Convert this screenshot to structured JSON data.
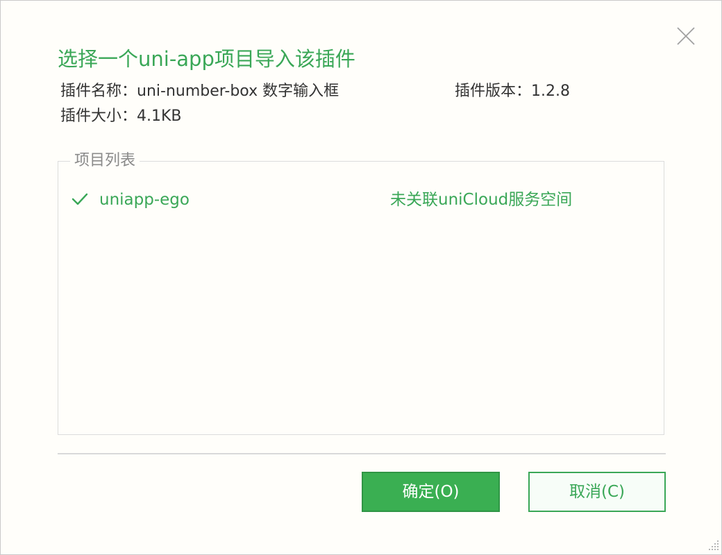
{
  "dialog": {
    "title": "选择一个uni-app项目导入该插件",
    "close_icon": "close-icon"
  },
  "plugin": {
    "name_text": "插件名称：uni-number-box 数字输入框",
    "version_text": "插件版本：1.2.8",
    "size_text": "插件大小：4.1KB"
  },
  "project_list": {
    "legend": "项目列表",
    "items": [
      {
        "name": "uniapp-ego",
        "status": "未关联uniCloud服务空间",
        "selected": true,
        "icon": "check-icon"
      }
    ]
  },
  "buttons": {
    "ok": "确定(O)",
    "cancel": "取消(C)"
  },
  "colors": {
    "accent": "#3aa757",
    "primary_button": "#3aaf52",
    "background": "#fffefa",
    "border": "#dcdcdc"
  }
}
